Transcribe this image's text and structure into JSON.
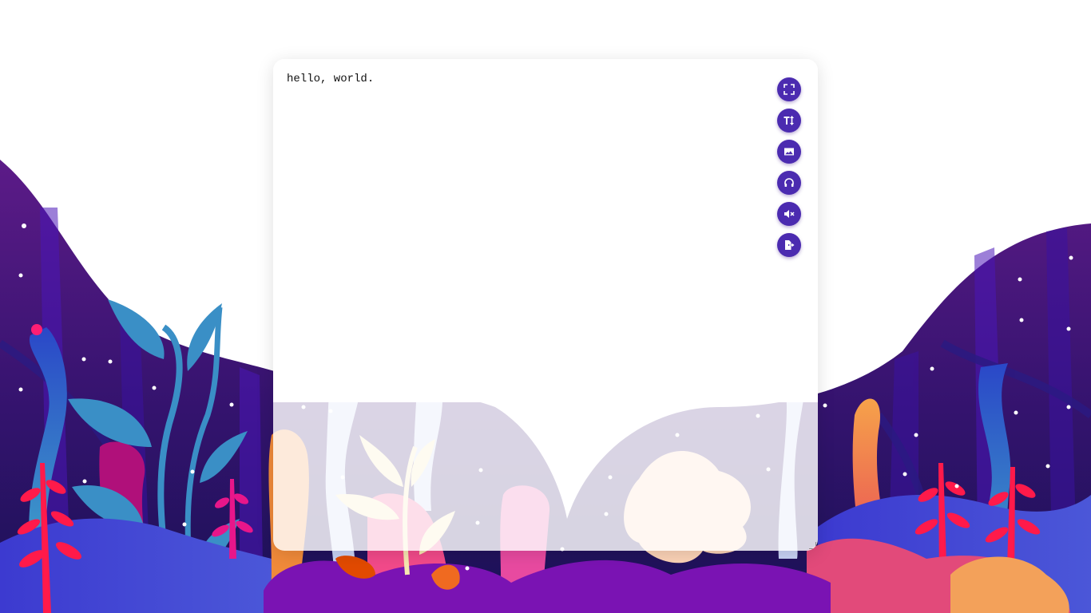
{
  "editor": {
    "text": "hello, world."
  },
  "toolbar": {
    "buttons": [
      {
        "name": "fullscreen",
        "icon": "fullscreen-icon"
      },
      {
        "name": "text-size",
        "icon": "text-size-icon"
      },
      {
        "name": "background",
        "icon": "image-icon"
      },
      {
        "name": "ambient-sound",
        "icon": "headphones-icon"
      },
      {
        "name": "mute",
        "icon": "volume-mute-icon"
      },
      {
        "name": "export",
        "icon": "file-export-icon"
      }
    ]
  },
  "colors": {
    "button": "#4b2bb0",
    "sky_purple": "#5a1a86",
    "deep_indigo": "#1b1660",
    "leaf_blue": "#3a8fc6",
    "coral_red": "#e8104a",
    "orange": "#f08a3a",
    "magenta": "#b0107a"
  }
}
